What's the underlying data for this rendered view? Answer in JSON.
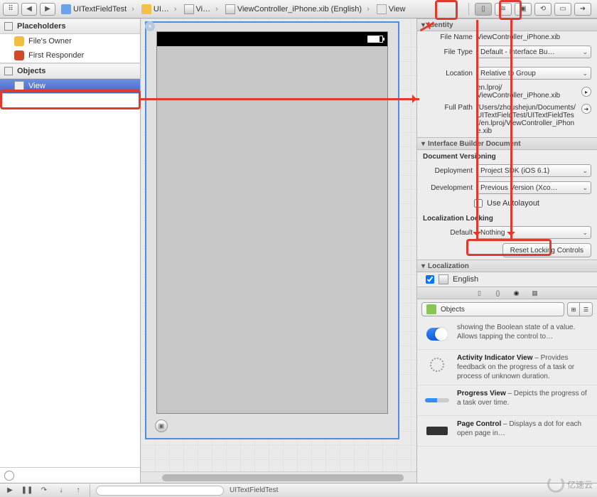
{
  "breadcrumb": [
    {
      "label": "UITextFieldTest",
      "icon": "proj"
    },
    {
      "label": "UI…",
      "icon": "folder"
    },
    {
      "label": "Vi…",
      "icon": "xib"
    },
    {
      "label": "ViewController_iPhone.xib (English)",
      "icon": "xib"
    },
    {
      "label": "View",
      "icon": "view"
    }
  ],
  "navigator": {
    "placeholders_title": "Placeholders",
    "files_owner": "File's Owner",
    "first_responder": "First Responder",
    "objects_title": "Objects",
    "view": "View"
  },
  "inspector": {
    "identity_title": "Identity",
    "file_name_label": "File Name",
    "file_name": "ViewController_iPhone.xib",
    "file_type_label": "File Type",
    "file_type": "Default - Interface Bu…",
    "location_label": "Location",
    "location": "Relative to Group",
    "location_sub": "en.lproj/\nViewController_iPhone.xib",
    "full_path_label": "Full Path",
    "full_path": "/Users/zhoushejun/Documents/UITextFieldTest/UITextFieldTest/en.lproj/ViewController_iPhone.xib",
    "ibd_title": "Interface Builder Document",
    "doc_ver_title": "Document Versioning",
    "deployment_label": "Deployment",
    "deployment": "Project SDK (iOS 6.1)",
    "development_label": "Development",
    "development": "Previous Version (Xco…",
    "use_autolayout": "Use Autolayout",
    "loc_lock_title": "Localization Locking",
    "default_label": "Default",
    "default_val": "Nothing",
    "reset_btn": "Reset Locking Controls",
    "localization_title": "Localization",
    "english": "English"
  },
  "library": {
    "filter_label": "Objects",
    "items": [
      {
        "title": "",
        "desc": "showing the Boolean state of a value. Allows tapping the control to…",
        "icon": "switch"
      },
      {
        "title": "Activity Indicator View",
        "desc": " – Provides feedback on the progress of a task or process of unknown duration.",
        "icon": "spinner"
      },
      {
        "title": "Progress View",
        "desc": " – Depicts the progress of a task over time.",
        "icon": "progress"
      },
      {
        "title": "Page Control",
        "desc": " – Displays a dot for each open page in…",
        "icon": "pagectrl"
      }
    ]
  },
  "statusbar": {
    "text": "UITextFieldTest"
  },
  "watermark": "亿速云"
}
